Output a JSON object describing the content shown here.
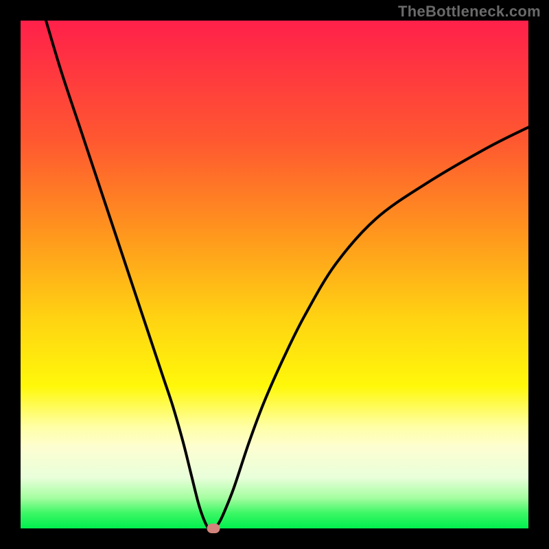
{
  "watermark": "TheBottleneck.com",
  "chart_data": {
    "type": "line",
    "title": "",
    "xlabel": "",
    "ylabel": "",
    "xlim": [
      0,
      100
    ],
    "ylim": [
      0,
      100
    ],
    "series": [
      {
        "name": "curve",
        "x": [
          5,
          8,
          12,
          16,
          20,
          24,
          28,
          30,
          32,
          33.5,
          35,
          36,
          37,
          38,
          39,
          40,
          42,
          45,
          48,
          52,
          56,
          62,
          70,
          80,
          92,
          100
        ],
        "values": [
          100,
          90,
          78,
          66,
          54,
          42,
          30,
          24,
          17,
          11,
          5,
          2,
          0,
          0,
          1,
          3,
          8,
          17,
          25,
          34,
          42,
          52,
          61,
          68,
          75,
          79
        ]
      }
    ],
    "marker": {
      "x": 38,
      "y": 0
    },
    "gradient_stops": [
      {
        "pos": 0,
        "color": "#ff204a"
      },
      {
        "pos": 24,
        "color": "#ff5930"
      },
      {
        "pos": 41,
        "color": "#ff931e"
      },
      {
        "pos": 59,
        "color": "#ffd412"
      },
      {
        "pos": 72,
        "color": "#fff80a"
      },
      {
        "pos": 80,
        "color": "#ffffa6"
      },
      {
        "pos": 84,
        "color": "#fdfed1"
      },
      {
        "pos": 90,
        "color": "#e8ffda"
      },
      {
        "pos": 94,
        "color": "#a5fda0"
      },
      {
        "pos": 97,
        "color": "#3cf765"
      },
      {
        "pos": 100,
        "color": "#00ef4e"
      }
    ]
  }
}
